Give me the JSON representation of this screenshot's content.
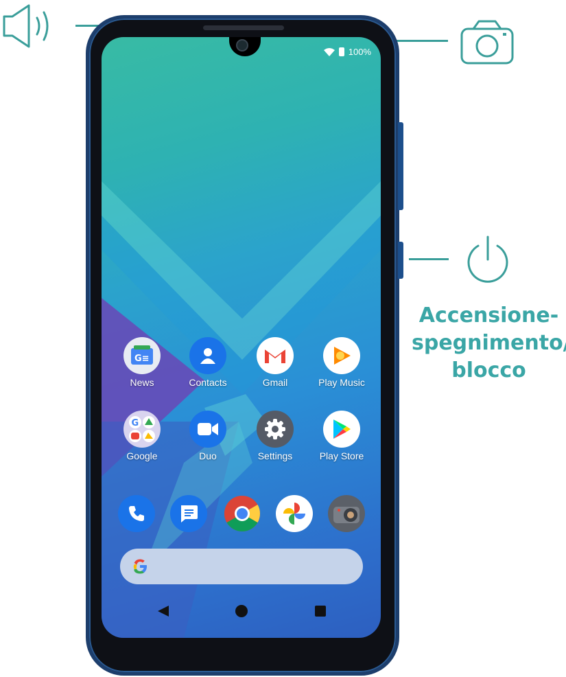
{
  "callouts": {
    "volume_icon": "speaker-icon",
    "camera_icon": "camera-icon",
    "power_icon": "power-icon",
    "power_label": [
      "Accensione-",
      "spegnimento/",
      "blocco"
    ]
  },
  "status_bar": {
    "battery": "100%"
  },
  "home_apps": [
    {
      "label": "News",
      "icon": "news-icon"
    },
    {
      "label": "Contacts",
      "icon": "contacts-icon"
    },
    {
      "label": "Gmail",
      "icon": "gmail-icon"
    },
    {
      "label": "Play Music",
      "icon": "play-music-icon"
    },
    {
      "label": "Google",
      "icon": "google-folder-icon"
    },
    {
      "label": "Duo",
      "icon": "duo-icon"
    },
    {
      "label": "Settings",
      "icon": "settings-icon"
    },
    {
      "label": "Play Store",
      "icon": "play-store-icon"
    }
  ],
  "dock": [
    "phone-icon",
    "messages-icon",
    "chrome-icon",
    "photos-icon",
    "camera-app-icon"
  ],
  "nav_bar": [
    "back-button",
    "home-button",
    "recents-button"
  ],
  "colors": {
    "accent": "#3aa6a6",
    "frame": "#1d3e6c"
  }
}
